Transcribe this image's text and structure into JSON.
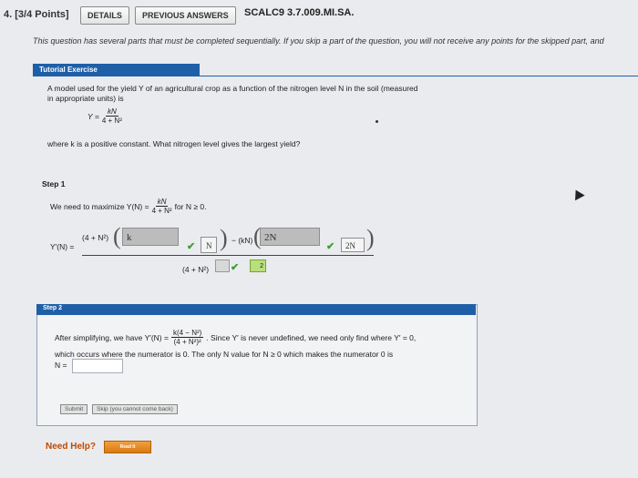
{
  "header": {
    "question_num": "4.",
    "points": "[3/4 Points]",
    "details_label": "DETAILS",
    "prev_answers_label": "PREVIOUS ANSWERS",
    "code": "SCALC9 3.7.009.MI.SA."
  },
  "intro": "This question has several parts that must be completed sequentially. If you skip a part of the question, you will not receive any points for the skipped part, and",
  "tutorial": {
    "title": "Tutorial Exercise",
    "prompt_line1": "A model used for the yield Y of an agricultural crop as a function of the nitrogen level N in the soil (measured",
    "prompt_line2": "in appropriate units) is",
    "formula_lhs": "Y =",
    "formula_num": "kN",
    "formula_den": "4 + N²",
    "question": "where k is a positive constant. What nitrogen level gives the largest yield?"
  },
  "step1": {
    "label": "Step 1",
    "text": "We need to maximize Y(N) =",
    "num": "kN",
    "den": "4 + N²",
    "cond": "for N ≥ 0.",
    "yprime": "Y′(N) =",
    "term1": "(4 + N²)",
    "field1": "k",
    "field2": "N",
    "minus": "− (kN)",
    "field3": "2N",
    "field4": "2N",
    "den_expr": "(4 + N²)",
    "exp_field": "2"
  },
  "step2": {
    "label": "Step 2",
    "line1a": "After simplifying, we have Y′(N) =",
    "num": "k(4 − N²)",
    "den": "(4 + N²)²",
    "line1b": ". Since Y′ is never undefined, we need only find where Y′ = 0,",
    "line2": "which occurs where the numerator is 0. The only N value for N ≥ 0 which makes the numerator 0 is",
    "n_label": "N =",
    "n_value": "",
    "submit_label": "Submit",
    "skip_label": "Skip (you cannot come back)"
  },
  "help": {
    "label": "Need Help?",
    "read_label": "Read It"
  }
}
